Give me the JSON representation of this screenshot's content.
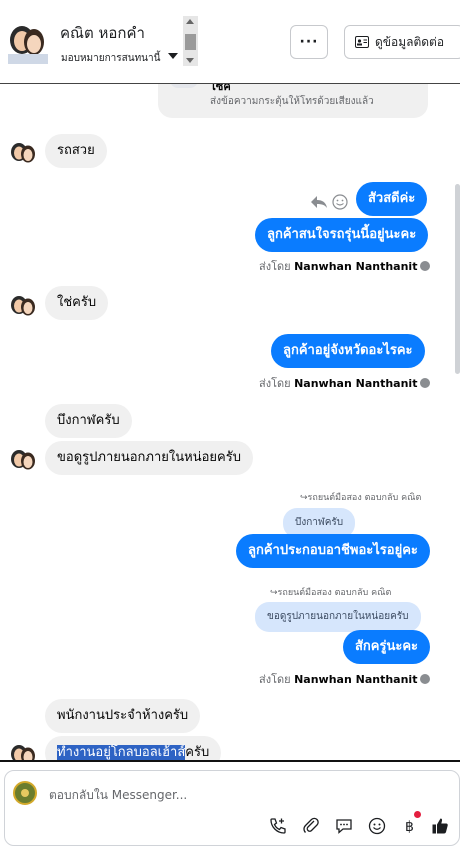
{
  "header": {
    "contact_name": "คณิต หอกคำ",
    "assign_label": "มอบหมายการสนทนานี้",
    "more_label": "···",
    "contact_info_label": "ดูข้อมูลติดต่อ"
  },
  "thread": {
    "system_cut_text": "โซค",
    "system_note": "ส่งข้อความกระตุ้นให้โทรด้วยเสียงแล้ว",
    "messages": [
      {
        "text": "รถสวย"
      },
      {
        "text": "สัวสดีค่ะ"
      },
      {
        "text": "ลูกค้าสนใจรถรุ่นนี้อยู่นะคะ"
      },
      {
        "text": "ใช่ครับ"
      },
      {
        "text": "ลูกค้าอยู่จังหวัดอะไรคะ"
      },
      {
        "text": "บึงกาฬครับ"
      },
      {
        "text": "ขอดูรูปภายนอกภายในหน่อยครับ"
      },
      {
        "text": "ลูกค้าประกอบอาชีพอะไรอยู่คะ"
      },
      {
        "text": "สักครู่นะคะ"
      },
      {
        "text": "พนักงานประจำห้างครับ"
      },
      {
        "text_highlighted": "ทำงานอยู่โกลบอลเฮ้าส์",
        "text_rest": "ครับ"
      }
    ],
    "sent_by_prefix": "ส่งโดย",
    "sent_by_name": "Nanwhan Nanthanit",
    "reply_header_1": "รถยนต์มือสอง ตอบกลับ คณิต",
    "quote_1": "บึงกาฬครับ",
    "reply_header_2": "รถยนต์มือสอง ตอบกลับ คณิต",
    "quote_2": "ขอดูรูปภายนอกภายในหน่อยครับ"
  },
  "composer": {
    "placeholder": "ตอบกลับใน Messenger..."
  },
  "icons": [
    "reply-icon",
    "emoji-icon",
    "call-add-icon",
    "attach-icon",
    "saved-reply-icon",
    "emoji-icon",
    "baht-icon",
    "like-icon"
  ],
  "colors": {
    "outgoing": "#0a7cff",
    "incoming": "#f0f0f0",
    "quote": "#d6e6fc"
  }
}
